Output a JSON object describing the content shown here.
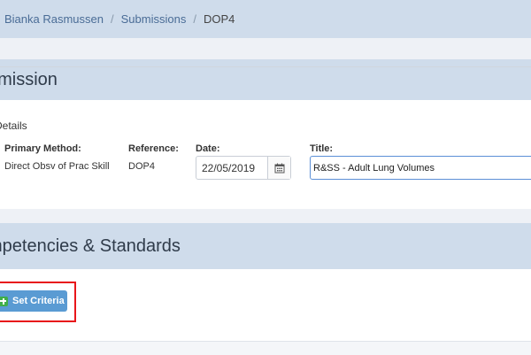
{
  "breadcrumb": {
    "items": [
      "Bianka Rasmussen",
      "Submissions"
    ],
    "current": "DOP4",
    "separator": "/"
  },
  "submission": {
    "title": "bmission",
    "details_legend": "Details",
    "primary_method_label": "Primary Method:",
    "primary_method_value": "Direct Obsv of Prac Skill",
    "reference_label": "Reference:",
    "reference_value": "DOP4",
    "date_label": "Date:",
    "date_value": "22/05/2019",
    "title_label": "Title:",
    "title_value": "R&SS - Adult Lung Volumes"
  },
  "competencies": {
    "title": "mpetencies & Standards",
    "set_criteria_label": "Set Criteria"
  },
  "colors": {
    "header_bg": "#cfdceb",
    "link": "#4a6c96",
    "button": "#5a9bd3",
    "highlight": "#e8161a",
    "plus": "#3fae49"
  }
}
